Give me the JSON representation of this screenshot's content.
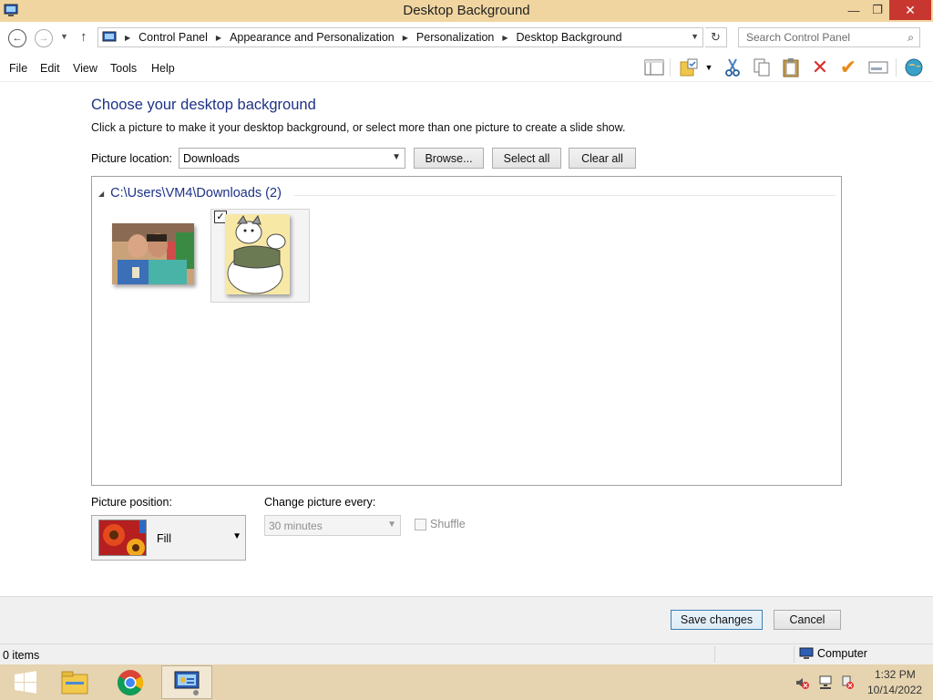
{
  "window": {
    "title": "Desktop Background",
    "minimize_glyph": "—",
    "maximize_glyph": "❐",
    "close_glyph": "✕"
  },
  "address_bar": {
    "breadcrumbs": [
      "Control Panel",
      "Appearance and Personalization",
      "Personalization",
      "Desktop Background"
    ],
    "search_placeholder": "Search Control Panel"
  },
  "menu": {
    "items": [
      "File",
      "Edit",
      "View",
      "Tools",
      "Help"
    ]
  },
  "toolbar": {
    "icons": [
      "layout-icon",
      "folder-options-icon",
      "cut-icon",
      "copy-icon",
      "paste-icon",
      "delete-icon",
      "check-icon",
      "properties-icon",
      "globe-icon"
    ]
  },
  "main": {
    "heading": "Choose your desktop background",
    "subtext": "Click a picture to make it your desktop background, or select more than one picture to create a slide show.",
    "location_label": "Picture location:",
    "location_value": "Downloads",
    "browse_label": "Browse...",
    "select_all_label": "Select all",
    "clear_all_label": "Clear all",
    "group_header": "C:\\Users\\VM4\\Downloads (2)",
    "thumbnails": [
      {
        "name": "photo-two-men",
        "selected": false
      },
      {
        "name": "cartoon-wolf",
        "selected": true
      }
    ],
    "position_label": "Picture position:",
    "position_value": "Fill",
    "change_label": "Change picture every:",
    "change_value": "30 minutes",
    "shuffle_label": "Shuffle"
  },
  "footer": {
    "save_label": "Save changes",
    "cancel_label": "Cancel"
  },
  "status_bar": {
    "items_text": "0 items",
    "location_text": "Computer"
  },
  "taskbar": {
    "apps": [
      "start-windows-icon",
      "file-explorer-icon",
      "chrome-icon",
      "control-panel-icon"
    ],
    "time": "1:32 PM",
    "date": "10/14/2022"
  },
  "colors": {
    "titlebar": "#f0d5a0",
    "heading": "#1e3287",
    "close_button": "#c7372f",
    "taskbar": "#e6d4b0"
  }
}
